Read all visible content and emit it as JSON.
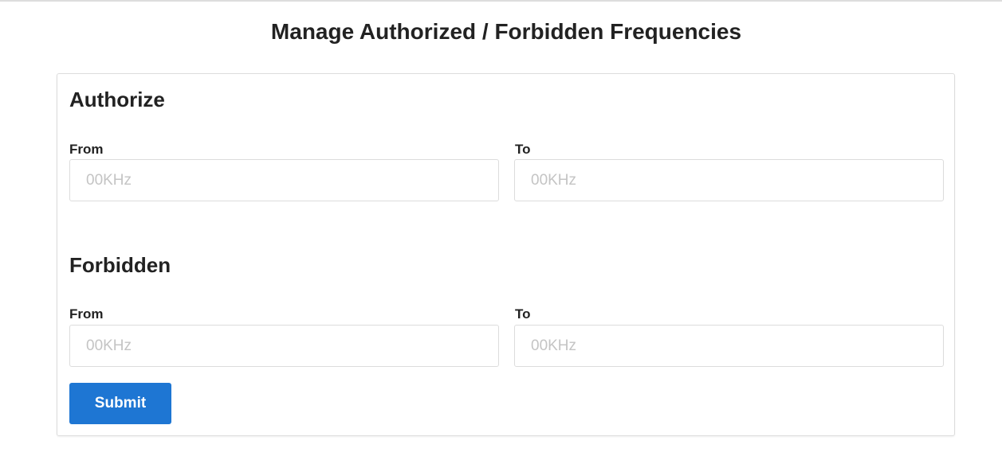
{
  "page_title": "Manage Authorized / Forbidden Frequencies",
  "authorize": {
    "heading": "Authorize",
    "from_label": "From",
    "from_placeholder": "00KHz",
    "from_value": "",
    "to_label": "To",
    "to_placeholder": "00KHz",
    "to_value": ""
  },
  "forbidden": {
    "heading": "Forbidden",
    "from_label": "From",
    "from_placeholder": "00KHz",
    "from_value": "",
    "to_label": "To",
    "to_placeholder": "00KHz",
    "to_value": ""
  },
  "submit_label": "Submit",
  "colors": {
    "accent": "#1e76d3"
  }
}
